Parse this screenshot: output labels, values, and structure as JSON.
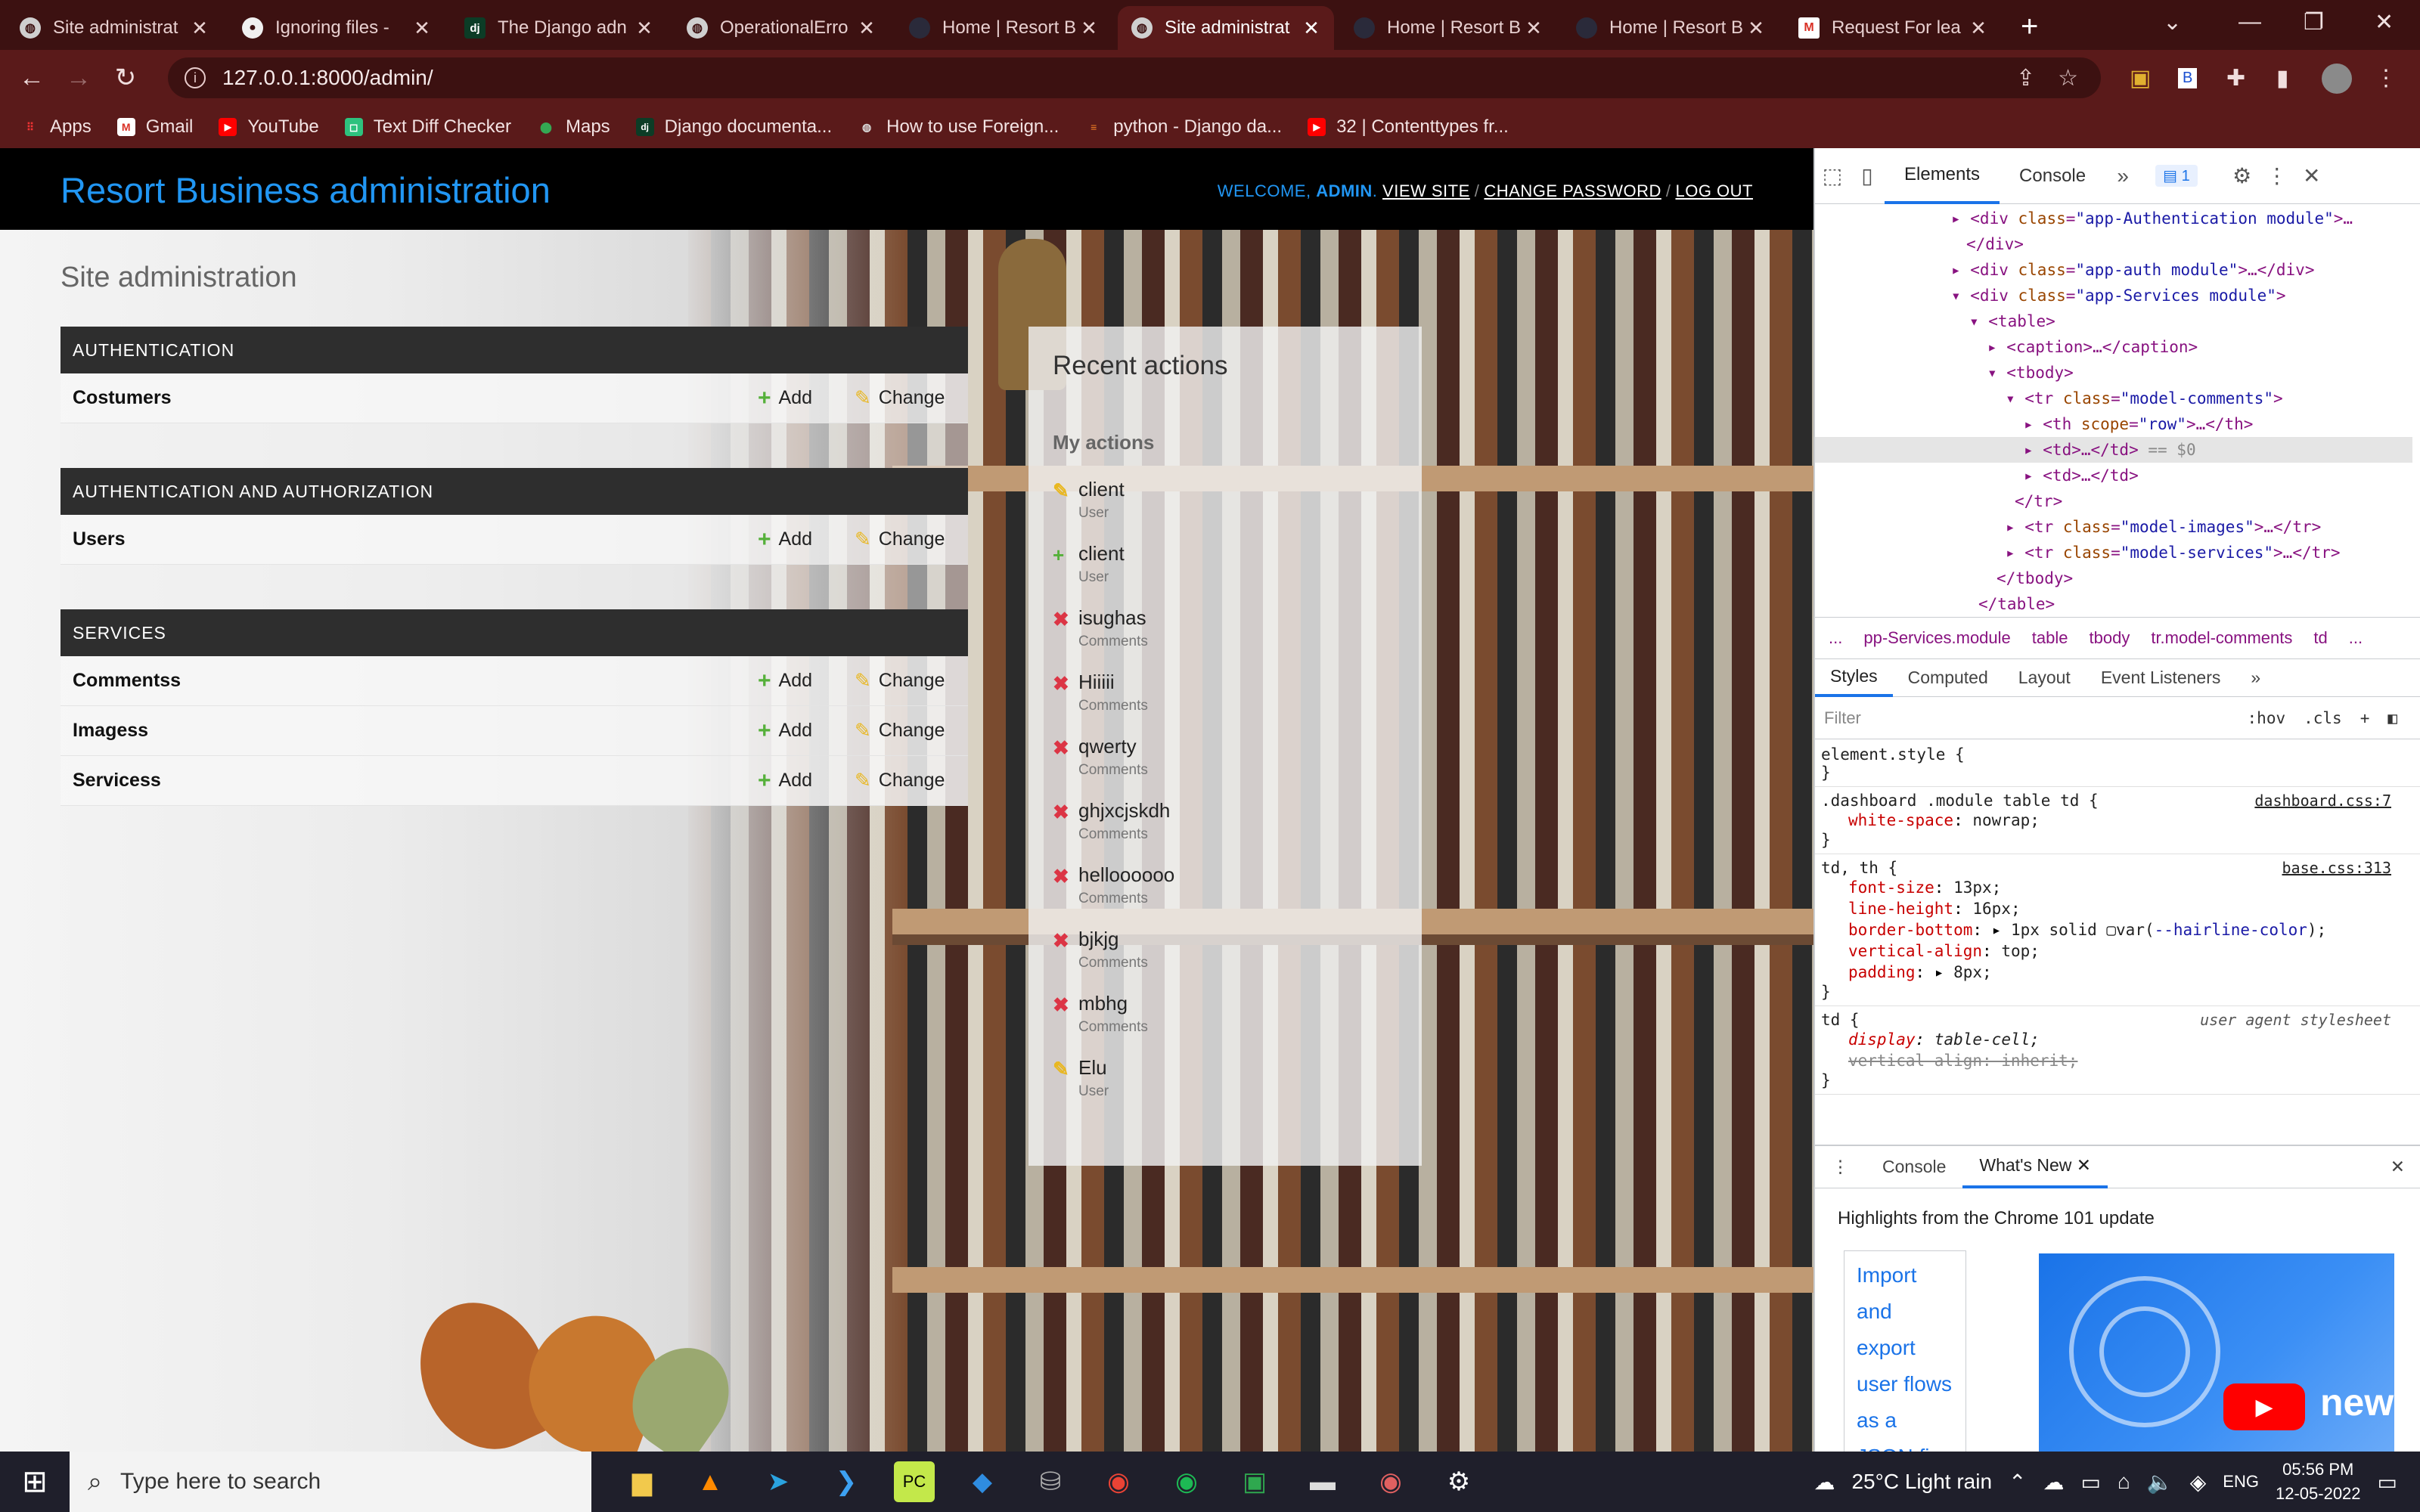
{
  "browser": {
    "tabs": [
      {
        "title": "Site administrat",
        "favicon": "globe"
      },
      {
        "title": "Ignoring files - ",
        "favicon": "github"
      },
      {
        "title": "The Django adn",
        "favicon": "django"
      },
      {
        "title": "OperationalErro",
        "favicon": "globe"
      },
      {
        "title": "Home | Resort B",
        "favicon": "dark"
      },
      {
        "title": "Site administrat",
        "favicon": "globe",
        "active": true
      },
      {
        "title": "Home | Resort B",
        "favicon": "dark"
      },
      {
        "title": "Home | Resort B",
        "favicon": "dark"
      },
      {
        "title": "Request For lea",
        "favicon": "gmail"
      }
    ],
    "url": "127.0.0.1:8000/admin/",
    "bookmarks": [
      "Apps",
      "Gmail",
      "YouTube",
      "Text Diff Checker",
      "Maps",
      "Django documenta...",
      "How to use Foreign...",
      "python - Django da...",
      "32 | Contenttypes fr..."
    ]
  },
  "admin": {
    "branding": "Resort Business administration",
    "welcome": "WELCOME,",
    "user": "ADMIN",
    "view_site": "VIEW SITE",
    "change_password": "CHANGE PASSWORD",
    "log_out": "LOG OUT",
    "site_title": "Site administration",
    "add_label": "Add",
    "change_label": "Change",
    "modules": [
      {
        "caption": "AUTHENTICATION",
        "models": [
          "Costumers"
        ]
      },
      {
        "caption": "AUTHENTICATION AND AUTHORIZATION",
        "models": [
          "Users"
        ]
      },
      {
        "caption": "SERVICES",
        "models": [
          "Commentss",
          "Imagess",
          "Servicess"
        ]
      }
    ],
    "recent": {
      "title": "Recent actions",
      "subtitle": "My actions",
      "items": [
        {
          "action": "change",
          "name": "client",
          "type": "User"
        },
        {
          "action": "add",
          "name": "client",
          "type": "User"
        },
        {
          "action": "delete",
          "name": "isughas",
          "type": "Comments"
        },
        {
          "action": "delete",
          "name": "Hiiiii",
          "type": "Comments"
        },
        {
          "action": "delete",
          "name": "qwerty",
          "type": "Comments"
        },
        {
          "action": "delete",
          "name": "ghjxcjskdh",
          "type": "Comments"
        },
        {
          "action": "delete",
          "name": "helloooooo",
          "type": "Comments"
        },
        {
          "action": "delete",
          "name": "bjkjg",
          "type": "Comments"
        },
        {
          "action": "delete",
          "name": "mbhg",
          "type": "Comments"
        },
        {
          "action": "change",
          "name": "Elu",
          "type": "User"
        }
      ]
    }
  },
  "devtools": {
    "tabs": [
      "Elements",
      "Console"
    ],
    "issues_count": "1",
    "breadcrumbs": [
      "...",
      "pp-Services.module",
      "table",
      "tbody",
      "tr.model-comments",
      "td",
      "..."
    ],
    "style_tabs": [
      "Styles",
      "Computed",
      "Layout",
      "Event Listeners"
    ],
    "filter_placeholder": "Filter",
    "filter_hov": ":hov",
    "filter_cls": ".cls",
    "drawer_tabs": [
      "Console",
      "What's New"
    ],
    "highlights": "Highlights from the Chrome 101 update",
    "whats_new_link": "Import and export user flows as a JSON fi",
    "whats_new_video_text": "new"
  },
  "taskbar": {
    "search_placeholder": "Type here to search",
    "weather": "25°C  Light rain",
    "lang": "ENG",
    "time": "05:56 PM",
    "date": "12-05-2022"
  }
}
